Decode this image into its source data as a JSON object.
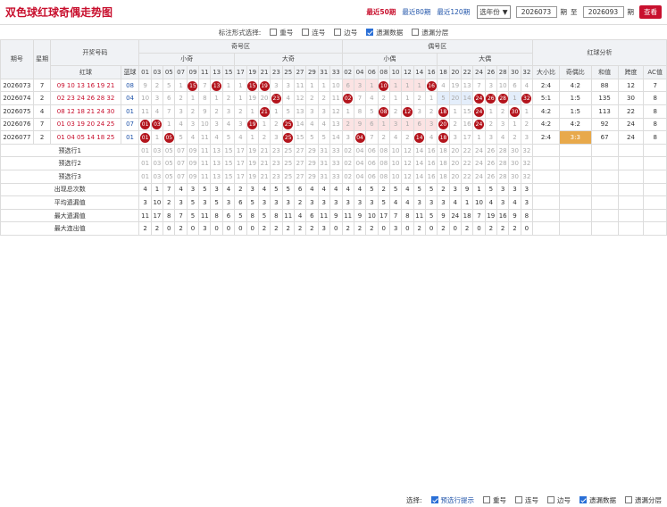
{
  "top": {
    "title": "双色球红球奇偶走势图",
    "links": [
      "最近50期",
      "最近80期",
      "最近120期"
    ],
    "active": 0,
    "year_select": "选年份",
    "from_issue": "2026073",
    "to_issue": "2026093",
    "qi": "期",
    "zhi": "至",
    "view_btn": "查看"
  },
  "opts": {
    "label": "标注形式选择:",
    "items": [
      {
        "t": "重号",
        "on": false
      },
      {
        "t": "连号",
        "on": false
      },
      {
        "t": "边号",
        "on": false
      },
      {
        "t": "遗漏数据",
        "on": true
      },
      {
        "t": "遗漏分层",
        "on": false
      }
    ]
  },
  "head": {
    "qihao": "期号",
    "xingqi": "星期",
    "kaijiang": "开奖号码",
    "red": "红球",
    "blue": "蓝球",
    "jiqu": "奇号区",
    "ouqu": "偶号区",
    "xiaoji": "小奇",
    "daji": "大奇",
    "xiaoou": "小偶",
    "daou": "大偶",
    "analysis": "红球分析",
    "dxb": "大小比",
    "job": "奇偶比",
    "hz": "和值",
    "kd": "跨度",
    "ac": "AC值",
    "sort": "⇕"
  },
  "cols": [
    "01",
    "03",
    "05",
    "07",
    "09",
    "11",
    "13",
    "15",
    "17",
    "19",
    "21",
    "23",
    "25",
    "27",
    "29",
    "31",
    "33",
    "02",
    "04",
    "06",
    "08",
    "10",
    "12",
    "14",
    "16",
    "18",
    "20",
    "22",
    "24",
    "26",
    "28",
    "30",
    "32"
  ],
  "rows": [
    {
      "issue": "2026073",
      "week": "7",
      "red": "09 10 13 16 19 21",
      "blue": "08",
      "cells": [
        "9",
        "2",
        "5",
        "1",
        "15",
        "7",
        "13",
        "1",
        "1",
        "15",
        "19",
        "3",
        "3",
        "11",
        "1",
        "1",
        "10",
        "6",
        "3",
        "1",
        "10",
        "1",
        "1",
        "1",
        "16",
        "4",
        "19",
        "13",
        "7",
        "3",
        "10",
        "6",
        "4"
      ],
      "hits": [
        4,
        6,
        9,
        10,
        20,
        24
      ],
      "ana": [
        "2:4",
        "4:2",
        "88",
        "12",
        "7"
      ]
    },
    {
      "issue": "2026074",
      "week": "2",
      "red": "02 23 24 26 28 32",
      "blue": "04",
      "cells": [
        "10",
        "3",
        "6",
        "2",
        "1",
        "8",
        "1",
        "2",
        "1",
        "19",
        "20",
        "23",
        "4",
        "12",
        "2",
        "2",
        "11",
        "02",
        "7",
        "4",
        "2",
        "1",
        "1",
        "2",
        "1",
        "5",
        "20",
        "14",
        "24",
        "26",
        "28",
        "1",
        "32"
      ],
      "hits": [
        11,
        17,
        28,
        29,
        30,
        32
      ],
      "ana": [
        "5:1",
        "1:5",
        "135",
        "30",
        "8"
      ]
    },
    {
      "issue": "2026075",
      "week": "4",
      "red": "08 12 18 21 24 30",
      "blue": "01",
      "cells": [
        "11",
        "4",
        "7",
        "3",
        "2",
        "9",
        "2",
        "3",
        "2",
        "1",
        "21",
        "1",
        "5",
        "13",
        "3",
        "3",
        "12",
        "1",
        "8",
        "5",
        "08",
        "2",
        "12",
        "3",
        "2",
        "18",
        "1",
        "15",
        "24",
        "1",
        "2",
        "30",
        "1"
      ],
      "hits": [
        10,
        20,
        22,
        25,
        28,
        31
      ],
      "ana": [
        "4:2",
        "1:5",
        "113",
        "22",
        "8"
      ]
    },
    {
      "issue": "2026076",
      "week": "7",
      "red": "01 03 19 20 24 25",
      "blue": "07",
      "cells": [
        "01",
        "03",
        "1",
        "4",
        "3",
        "10",
        "3",
        "4",
        "3",
        "19",
        "1",
        "2",
        "25",
        "14",
        "4",
        "4",
        "13",
        "2",
        "9",
        "6",
        "1",
        "3",
        "1",
        "6",
        "3",
        "20",
        "2",
        "16",
        "24",
        "2",
        "3",
        "1",
        "2"
      ],
      "hits": [
        0,
        1,
        9,
        12,
        25,
        28
      ],
      "ana": [
        "4:2",
        "4:2",
        "92",
        "24",
        "8"
      ]
    },
    {
      "issue": "2026077",
      "week": "2",
      "red": "01 04 05 14 18 25",
      "blue": "01",
      "cells": [
        "01",
        "1",
        "05",
        "5",
        "4",
        "11",
        "4",
        "5",
        "4",
        "1",
        "2",
        "3",
        "25",
        "15",
        "5",
        "5",
        "14",
        "3",
        "04",
        "7",
        "2",
        "4",
        "2",
        "14",
        "4",
        "18",
        "3",
        "17",
        "1",
        "3",
        "4",
        "2",
        "3"
      ],
      "hits": [
        0,
        2,
        12,
        18,
        23,
        25
      ],
      "ana": [
        "2:4",
        "3:3",
        "67",
        "24",
        "8"
      ]
    }
  ],
  "foot": {
    "pre1": "预选行1",
    "pre2": "预选行2",
    "pre3": "预选行3",
    "appear": "出现总次数",
    "avgmiss": "平均遗漏值",
    "maxmiss": "最大遗漏值",
    "maxcont": "最大连出值",
    "kaijiang": "开奖号码",
    "bottom_label": "选择:",
    "bottom_items": [
      {
        "t": "预选行提示",
        "on": true
      },
      {
        "t": "重号",
        "on": false
      },
      {
        "t": "连号",
        "on": false
      },
      {
        "t": "边号",
        "on": false
      },
      {
        "t": "遗漏数据",
        "on": true
      },
      {
        "t": "遗漏分层",
        "on": false
      }
    ],
    "appear_vals": [
      "4",
      "1",
      "7",
      "4",
      "3",
      "5",
      "3",
      "4",
      "2",
      "3",
      "4",
      "5",
      "5",
      "6",
      "4",
      "4",
      "4",
      "4",
      "4",
      "5",
      "2",
      "5",
      "4",
      "5",
      "5",
      "2",
      "3",
      "9",
      "1",
      "5",
      "3",
      "3",
      "3"
    ],
    "avg_vals": [
      "3",
      "10",
      "2",
      "3",
      "5",
      "3",
      "5",
      "3",
      "6",
      "5",
      "3",
      "3",
      "3",
      "2",
      "3",
      "3",
      "3",
      "3",
      "3",
      "3",
      "5",
      "4",
      "4",
      "3",
      "3",
      "3",
      "4",
      "1",
      "10",
      "4",
      "3",
      "4",
      "3"
    ],
    "max_vals": [
      "11",
      "17",
      "8",
      "7",
      "5",
      "11",
      "8",
      "6",
      "5",
      "8",
      "5",
      "8",
      "11",
      "4",
      "6",
      "11",
      "9",
      "11",
      "9",
      "10",
      "17",
      "7",
      "8",
      "11",
      "5",
      "9",
      "24",
      "18",
      "7",
      "19",
      "16",
      "9",
      "8"
    ],
    "cont_vals": [
      "2",
      "2",
      "0",
      "2",
      "0",
      "3",
      "0",
      "0",
      "0",
      "0",
      "2",
      "2",
      "2",
      "2",
      "2",
      "3",
      "0",
      "2",
      "2",
      "2",
      "0",
      "3",
      "0",
      "2",
      "0",
      "2",
      "0",
      "2",
      "0",
      "2",
      "2",
      "2",
      "0"
    ]
  }
}
